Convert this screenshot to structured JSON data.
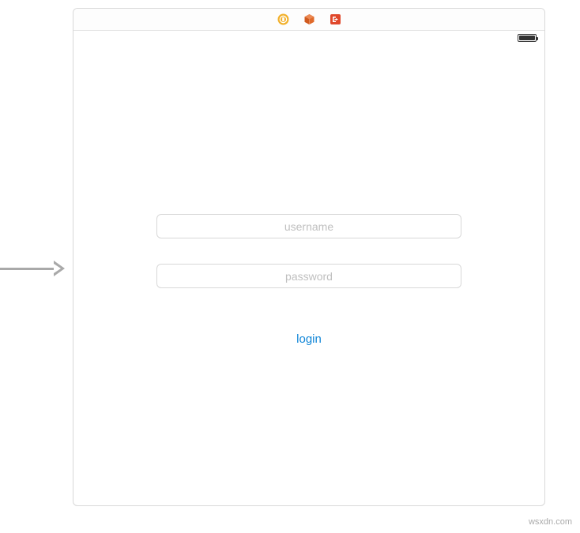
{
  "form": {
    "username_placeholder": "username",
    "password_placeholder": "password",
    "login_label": "login"
  },
  "watermark": "wsxdn.com",
  "icons": {
    "circle_color": "#F2B02A",
    "box_color": "#E06A2B",
    "exit_color": "#E0482B"
  }
}
